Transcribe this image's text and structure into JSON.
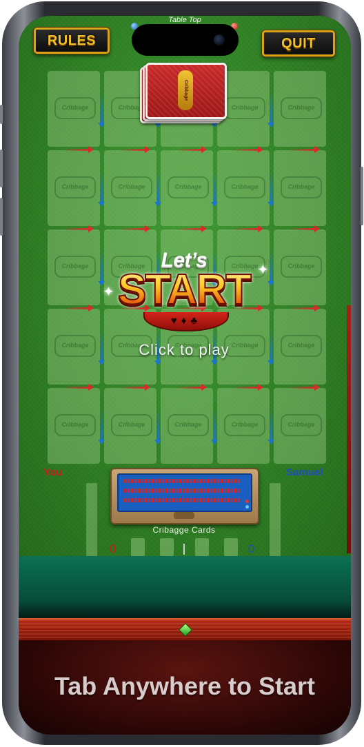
{
  "header": {
    "rules_label": "RULES",
    "quit_label": "QUIT",
    "title_tag": "Table Top"
  },
  "deck": {
    "logo_text": "Cribbage"
  },
  "grid": {
    "cell_logo_text": "Cribbage",
    "rows": 5,
    "cols": 5
  },
  "overlay": {
    "lets": "Let’s",
    "start": "START",
    "suits": "♥♦♣",
    "click_to_play": "Click to play"
  },
  "players": {
    "you": "You",
    "opponent": "Samuel"
  },
  "board": {
    "caption": "Cribagge Cards"
  },
  "scores": {
    "you": "0",
    "opponent": "0"
  },
  "footer": {
    "prompt": "Tab Anywhere to Start"
  },
  "colors": {
    "felt": "#2f8024",
    "player_you": "#c81d1d",
    "player_opponent": "#1f4fb8",
    "accent_gold": "#f2c12a"
  }
}
